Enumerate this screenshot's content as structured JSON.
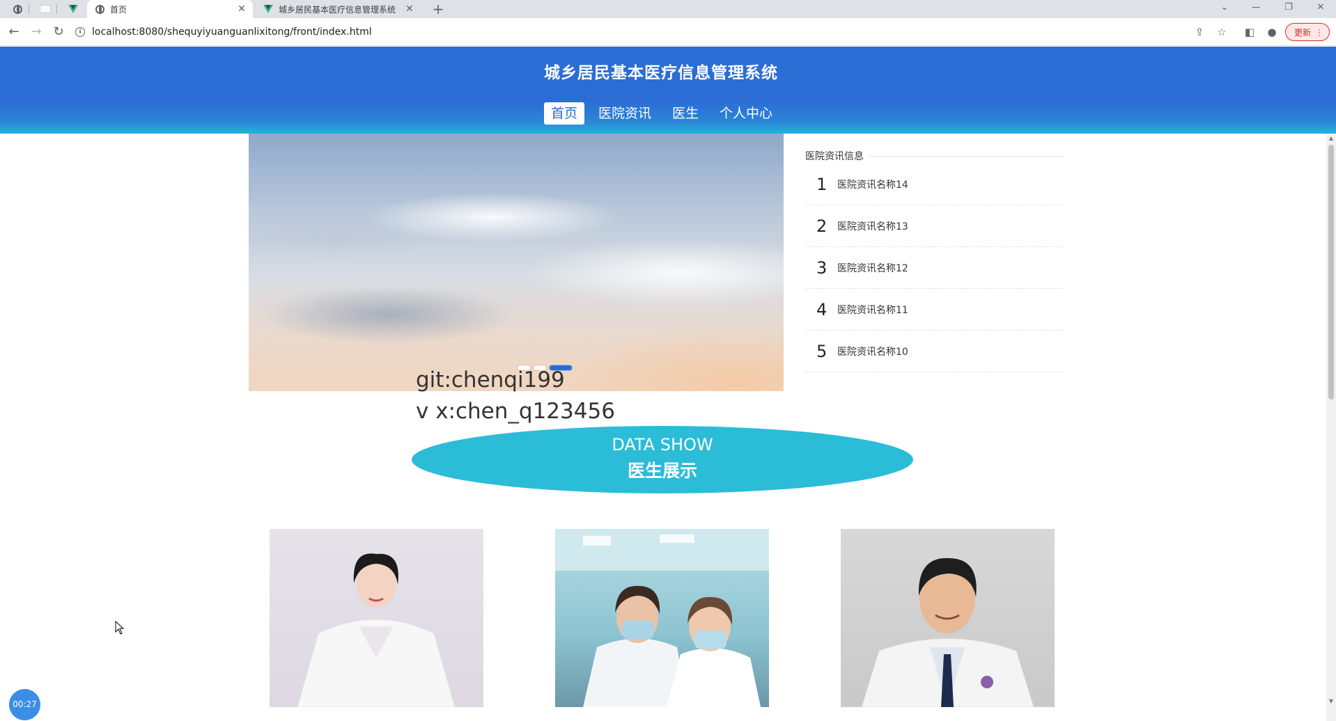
{
  "browser": {
    "tabs": [
      {
        "title": "首页",
        "active": true
      },
      {
        "title": "城乡居民基本医疗信息管理系统",
        "active": false
      }
    ],
    "new_tab": "+",
    "window_controls": {
      "minimize": "—",
      "restore": "❐",
      "close": "✕",
      "dropdown": "⌄"
    },
    "url": "localhost:8080/shequyiyuanguanlixitong/front/index.html",
    "update_label": "更新",
    "menu_icon": "⋮"
  },
  "site": {
    "title": "城乡居民基本医疗信息管理系统",
    "nav": [
      {
        "label": "首页",
        "active": true
      },
      {
        "label": "医院资讯",
        "active": false
      },
      {
        "label": "医生",
        "active": false
      },
      {
        "label": "个人中心",
        "active": false
      }
    ],
    "colors": {
      "primary": "#2b6dd4",
      "accent": "#2bbcd8"
    }
  },
  "banner": {
    "slides": 3,
    "active_slide": 3
  },
  "overlay": {
    "line1": "git:chenqi199",
    "line2": "v x:chen_q123456"
  },
  "news": {
    "title": "医院资讯信息",
    "items": [
      {
        "num": "1",
        "name": "医院资讯名称14"
      },
      {
        "num": "2",
        "name": "医院资讯名称13"
      },
      {
        "num": "3",
        "name": "医院资讯名称12"
      },
      {
        "num": "4",
        "name": "医院资讯名称11"
      },
      {
        "num": "5",
        "name": "医院资讯名称10"
      }
    ]
  },
  "data_show": {
    "en": "DATA SHOW",
    "cn": "医生展示"
  },
  "timer": "00:27"
}
